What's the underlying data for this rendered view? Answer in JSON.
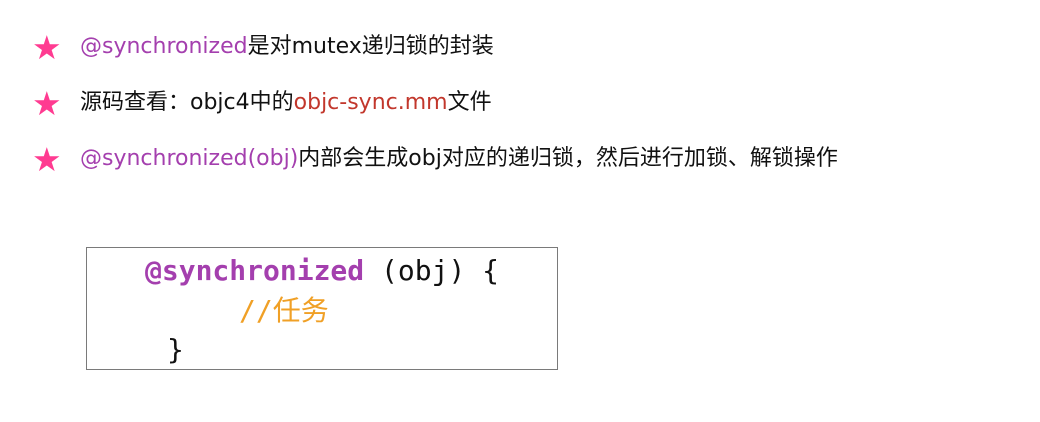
{
  "colors": {
    "star": "#ff3b91",
    "purple": "#a43fae",
    "red": "#c2372c",
    "text": "#111111",
    "comment": "#f0a026",
    "border": "#7a7a7a"
  },
  "bullets": [
    {
      "icon": "star-icon",
      "star": "★",
      "segments": [
        "@synchronized",
        "是对mutex递归锁的封装"
      ]
    },
    {
      "icon": "star-icon",
      "star": "★",
      "segments": [
        "源码查看：objc4中的",
        "objc-sync.mm",
        "文件"
      ]
    },
    {
      "icon": "star-icon",
      "star": "★",
      "segments": [
        "@synchronized(obj)",
        "内部会生成obj对应的递归锁，然后进行加锁、解锁操作"
      ]
    }
  ],
  "code": {
    "line1_keyword": "@synchronized",
    "line1_rest": " (obj) {",
    "line2_comment": "//任务",
    "line3": "}"
  }
}
